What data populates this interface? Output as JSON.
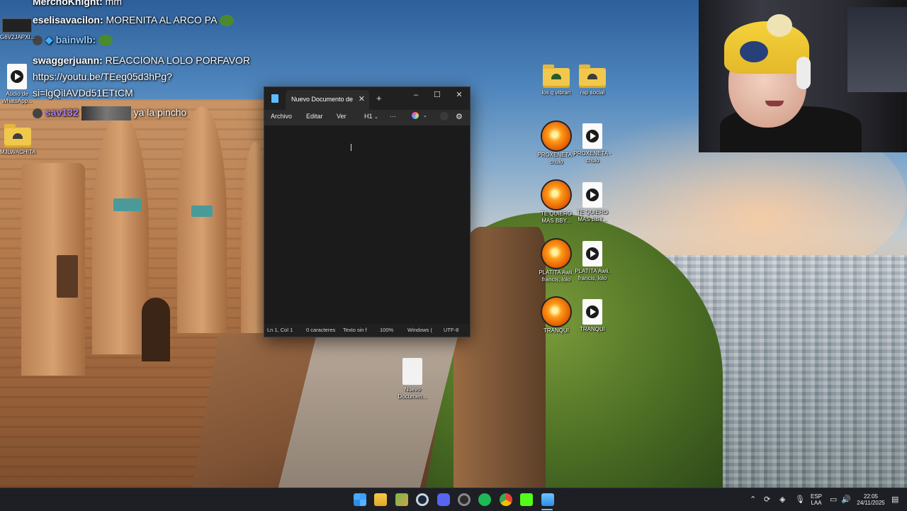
{
  "chat": {
    "lines": [
      {
        "user": "MerchoKnight:",
        "text": " mm"
      },
      {
        "user": "eselisavacilon:",
        "text": " MORENITA AL ARCO PA"
      },
      {
        "user": "bainwlb:",
        "text": ""
      },
      {
        "user": "swaggerjuann:",
        "text": " REACCIONA LOLO PORFAVOR"
      },
      {
        "user": "",
        "text": "https://youtu.be/TEeg05d3hPg?"
      },
      {
        "user": "",
        "text": "si=lgQiIAVDd51ETtCM"
      },
      {
        "user": "sav132",
        "text": "ya la pincho"
      }
    ]
  },
  "desktop_left": {
    "icon1_label": "G6V2JAPXI...",
    "icon2_label": "Audio de WhatsApp...",
    "icon3_label": "MJLWACHITA"
  },
  "desktop_right": {
    "icons": [
      {
        "label": "los q vibran"
      },
      {
        "label": "rap social"
      },
      {
        "label": "PROXENETA - chulo"
      },
      {
        "label": "PROXENETA - chulo"
      },
      {
        "label": "TE QUIERO MAS BBY..."
      },
      {
        "label": "TE QUIERO MAS BBY..."
      },
      {
        "label": "PLATITA Awii, francis, lolo"
      },
      {
        "label": "PLATITA Awii, francis, lolo"
      },
      {
        "label": "TRANQUI"
      },
      {
        "label": "TRANQUI"
      }
    ],
    "doc_label": "Nuevo Documen..."
  },
  "notepad": {
    "tab_title": "Nuevo Documento de",
    "menu": {
      "file": "Archivo",
      "edit": "Editar",
      "view": "Ver",
      "heading": "H1",
      "more": "···"
    },
    "status": {
      "position": "Ln 1, Col 1",
      "chars": "0 caracteres",
      "format": "Texto sin f",
      "zoom": "100%",
      "eol": "Windows (",
      "encoding": "UTF-8"
    }
  },
  "taskbar": {
    "lang_top": "ESP",
    "lang_bottom": "LAA",
    "time": "22:05",
    "date": "24/11/2025"
  },
  "colors": {
    "accent": "#74b9ff",
    "notepad_bg": "#1f1f1f",
    "chat_user_purple": "#b07cff"
  }
}
